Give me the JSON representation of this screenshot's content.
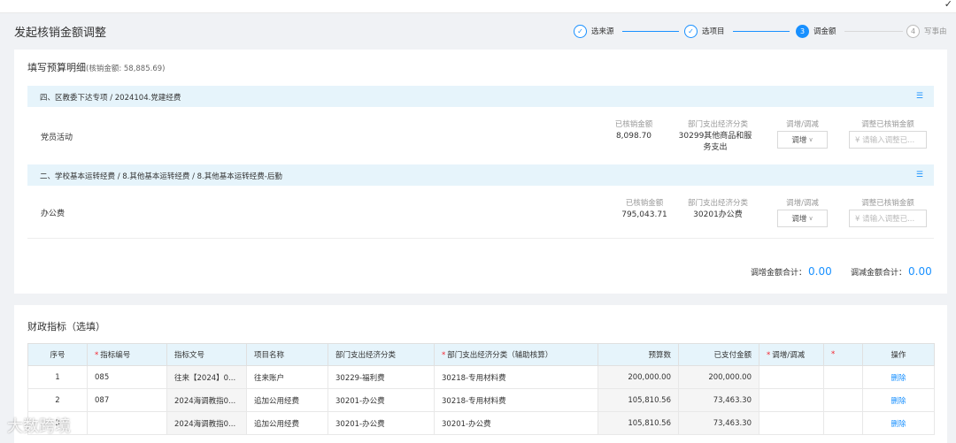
{
  "header": {
    "title": "发起核销金额调整"
  },
  "steps": [
    {
      "num": "✓",
      "label": "选来源",
      "state": "done"
    },
    {
      "num": "✓",
      "label": "选项目",
      "state": "done"
    },
    {
      "num": "3",
      "label": "调金额",
      "state": "active"
    },
    {
      "num": "4",
      "label": "写事由",
      "state": "pending"
    }
  ],
  "budget": {
    "title": "填写预算明细",
    "subtitle": "(核销金额: 58,885.69)",
    "groups": [
      {
        "crumb": "四、区教委下达专项  /  2024104.党建经费",
        "item": "党员活动",
        "label_amount": "已核销金额",
        "amount": "8,098.70",
        "label_category": "部门支出经济分类",
        "category": "30299其他商品和服务支出",
        "label_adjust": "调增/调减",
        "adjust": "调增",
        "label_input": "调整已核销金额",
        "input_placeholder": "¥  请输入调整已..."
      },
      {
        "crumb": "二、学校基本运转经费  /  8.其他基本运转经费  /  8.其他基本运转经费-后勤",
        "item": "办公费",
        "label_amount": "已核销金额",
        "amount": "795,043.71",
        "label_category": "部门支出经济分类",
        "category": "30201办公费",
        "label_adjust": "调增/调减",
        "adjust": "调增",
        "label_input": "调整已核销金额",
        "input_placeholder": "¥  请输入调整已..."
      }
    ],
    "total_increase_label": "调增金额合计：",
    "total_increase": "0.00",
    "total_decrease_label": "调减金额合计：",
    "total_decrease": "0.00"
  },
  "finance": {
    "title": "财政指标（选填）",
    "headers": [
      "序号",
      "指标编号",
      "指标文号",
      "项目名称",
      "部门支出经济分类",
      "部门支出经济分类（辅助核算）",
      "预算数",
      "已支付金额",
      "调增/调减",
      "",
      "操作"
    ],
    "rows": [
      [
        "1",
        "085",
        "往来【2024】0...",
        "往来账户",
        "30229-福利费",
        "30218-专用材料费",
        "200,000.00",
        "200,000.00",
        "",
        "",
        "删除"
      ],
      [
        "2",
        "087",
        "2024海调教指0...",
        "追加公用经费",
        "30201-办公费",
        "30218-专用材料费",
        "105,810.56",
        "73,463.30",
        "",
        "",
        "删除"
      ],
      [
        "3",
        "",
        "2024海调教指0...",
        "追加公用经费",
        "30201-办公费",
        "30201-办公费",
        "105,810.56",
        "73,463.30",
        "",
        "",
        "删除"
      ]
    ]
  },
  "watermark": "大数跨境"
}
